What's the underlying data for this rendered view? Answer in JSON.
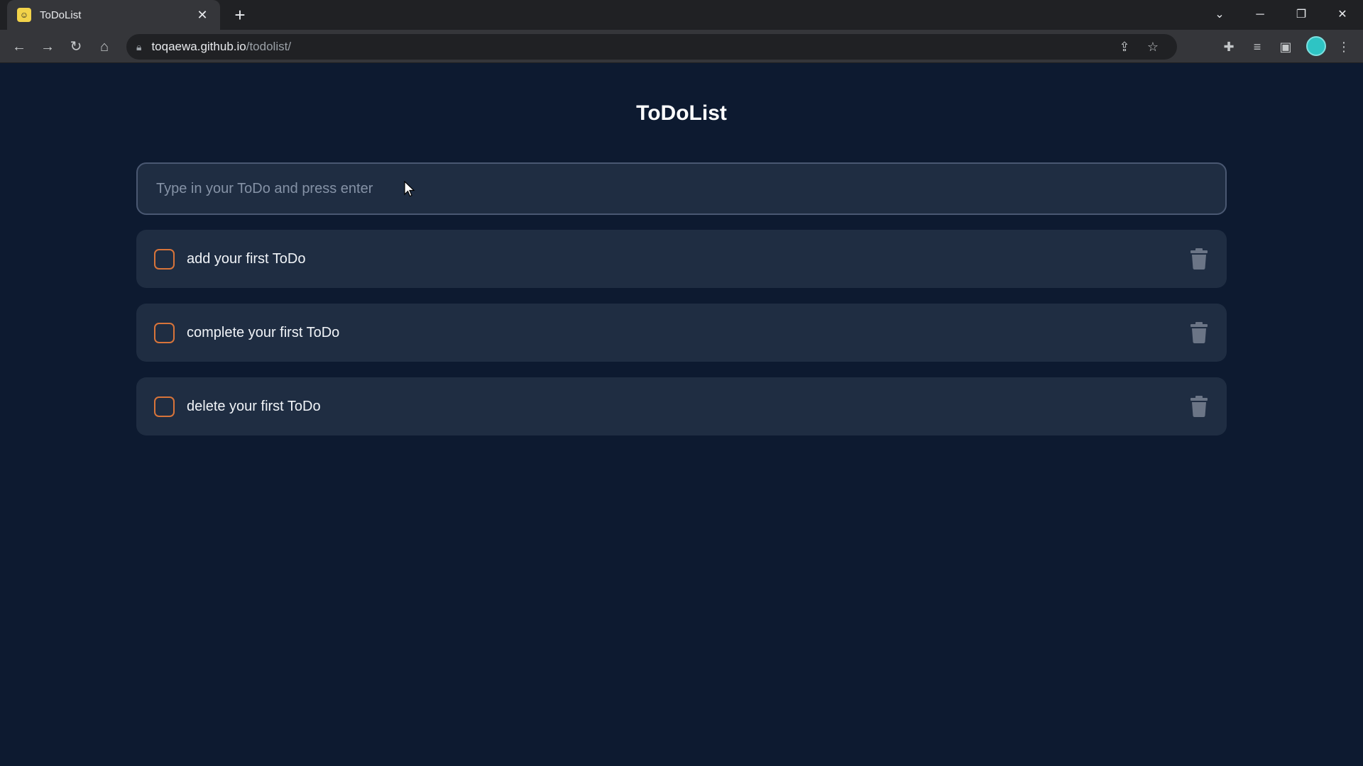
{
  "browser": {
    "tab_title": "ToDoList",
    "favicon_glyph": "☺",
    "url_host": "toqaewa.github.io",
    "url_path": "/todolist/",
    "accent": "#2ec4c4"
  },
  "page": {
    "title": "ToDoList",
    "input_placeholder": "Type in your ToDo and press enter",
    "input_value": ""
  },
  "todos": [
    {
      "text": "add your first ToDo",
      "done": false
    },
    {
      "text": "complete your first ToDo",
      "done": false
    },
    {
      "text": "delete your first ToDo",
      "done": false
    }
  ],
  "colors": {
    "background": "#0d1a30",
    "card": "#1f2d42",
    "checkbox_border": "#d8743a",
    "trash": "#6b7586"
  }
}
